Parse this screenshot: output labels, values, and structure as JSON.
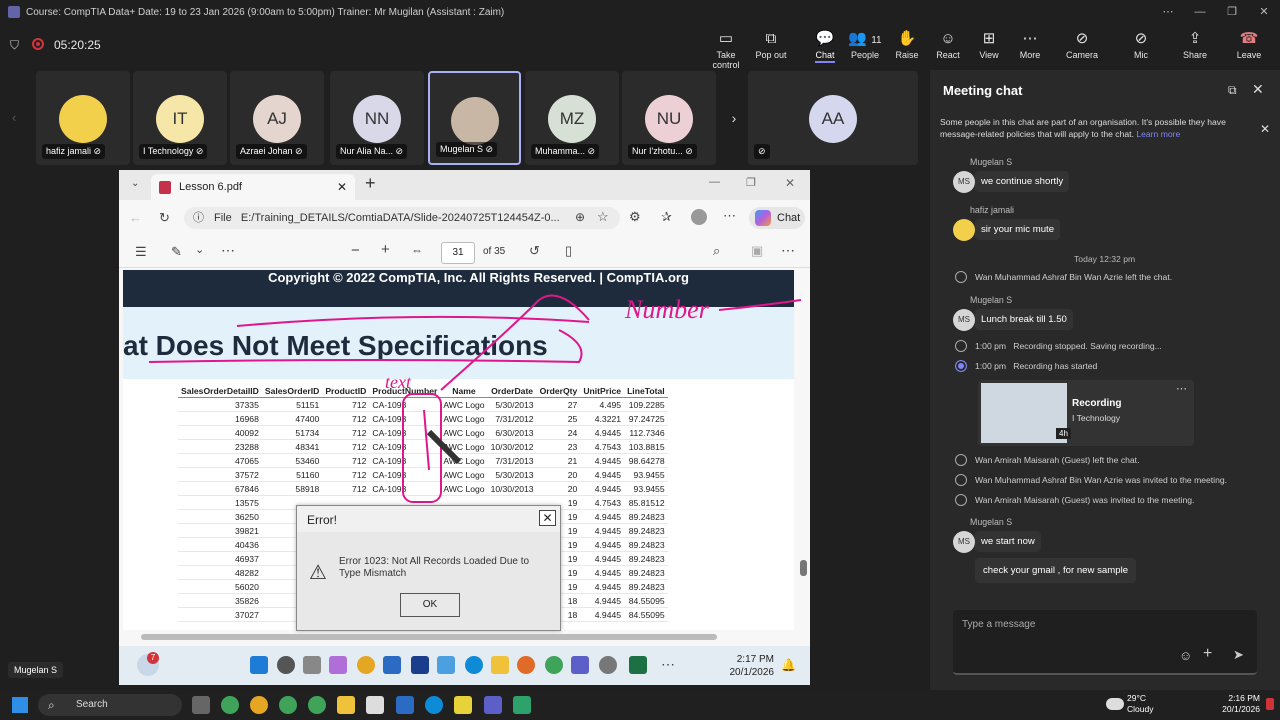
{
  "titlebar": {
    "text": "Course: CompTIA Data+ Date: 19 to 23 Jan 2026 (9:00am to 5:00pm) Trainer: Mr Mugilan (Assistant : Zaim)"
  },
  "toolbar": {
    "timer": "05:20:25",
    "buttons": [
      {
        "label": "Take control",
        "icon": "take-control-icon",
        "glyph": "▭"
      },
      {
        "label": "Pop out",
        "icon": "pop-out-icon",
        "glyph": "⧉"
      },
      {
        "label": "Chat",
        "icon": "chat-icon",
        "glyph": "💬"
      },
      {
        "label": "People",
        "icon": "people-icon",
        "glyph": "👥",
        "count": "11"
      },
      {
        "label": "Raise",
        "icon": "raise-hand-icon",
        "glyph": "✋"
      },
      {
        "label": "React",
        "icon": "react-icon",
        "glyph": "☺"
      },
      {
        "label": "View",
        "icon": "view-icon",
        "glyph": "⊞"
      },
      {
        "label": "More",
        "icon": "more-icon",
        "glyph": "⋯"
      },
      {
        "label": "Camera",
        "icon": "camera-off-icon",
        "glyph": "⊘"
      },
      {
        "label": "Mic",
        "icon": "mic-off-icon",
        "glyph": "⊘"
      },
      {
        "label": "Share",
        "icon": "share-icon",
        "glyph": "⇪"
      },
      {
        "label": "Leave",
        "icon": "leave-icon",
        "glyph": "☎"
      }
    ]
  },
  "participants": [
    {
      "name": "hafiz jamali",
      "initials": "",
      "color": "#f2d04b"
    },
    {
      "name": "I Technology",
      "initials": "IT",
      "color": "#f6e7a8"
    },
    {
      "name": "Azraei Johan",
      "initials": "AJ",
      "color": "#e5d5cf"
    },
    {
      "name": "Nur Alia Na...",
      "initials": "NN",
      "color": "#d8d8e8"
    },
    {
      "name": "Mugelan S",
      "initials": "",
      "color": "#c9b7a6"
    },
    {
      "name": "Muhamma...",
      "initials": "MZ",
      "color": "#d6e0d4"
    },
    {
      "name": "Nur I'zhotu...",
      "initials": "NU",
      "color": "#edd0d6"
    },
    {
      "name": "",
      "initials": "AA",
      "color": "#d4d7ee"
    }
  ],
  "browser": {
    "tab_title": "Lesson 6.pdf",
    "address_prefix": "File",
    "address": "E:/Training_DETAILS/ComtiaDATA/Slide-20240725T124454Z-0...",
    "copilot_label": "Chat",
    "page_current": "31",
    "page_total": "of 35"
  },
  "slide": {
    "header": "Copyright © 2022 CompTIA, Inc. All Rights Reserved.  |  CompTIA.org",
    "title": "at Does Not Meet Specifications",
    "columns": [
      "SalesOrderDetailID",
      "SalesOrderID",
      "ProductID",
      "ProductNumber",
      "Name",
      "OrderDate",
      "OrderQty",
      "UnitPrice",
      "LineTotal"
    ],
    "rows": [
      [
        "37335",
        "51151",
        "712",
        "CA-1098",
        "AWC Logo",
        "5/30/2013",
        "27",
        "4.495",
        "109.2285"
      ],
      [
        "16968",
        "47400",
        "712",
        "CA-1098",
        "AWC Logo",
        "7/31/2012",
        "25",
        "4.3221",
        "97.24725"
      ],
      [
        "40092",
        "51734",
        "712",
        "CA-1098",
        "AWC Logo",
        "6/30/2013",
        "24",
        "4.9445",
        "112.7346"
      ],
      [
        "23288",
        "48341",
        "712",
        "CA-1098",
        "AWC Logo",
        "10/30/2012",
        "23",
        "4.7543",
        "103.8815"
      ],
      [
        "47065",
        "53460",
        "712",
        "CA-1098",
        "AWC Logo",
        "7/31/2013",
        "21",
        "4.9445",
        "98.64278"
      ],
      [
        "37572",
        "51160",
        "712",
        "CA-1098",
        "AWC Logo",
        "5/30/2013",
        "20",
        "4.9445",
        "93.9455"
      ],
      [
        "67846",
        "58918",
        "712",
        "CA-1098",
        "AWC Logo",
        "10/30/2013",
        "20",
        "4.9445",
        "93.9455"
      ],
      [
        "13575",
        "",
        "",
        "",
        "",
        "",
        "19",
        "4.7543",
        "85.81512"
      ],
      [
        "36250",
        "",
        "",
        "",
        "",
        "",
        "19",
        "4.9445",
        "89.24823"
      ],
      [
        "39821",
        "",
        "",
        "",
        "",
        "",
        "19",
        "4.9445",
        "89.24823"
      ],
      [
        "40436",
        "",
        "",
        "",
        "",
        "",
        "19",
        "4.9445",
        "89.24823"
      ],
      [
        "46937",
        "",
        "",
        "",
        "",
        "",
        "19",
        "4.9445",
        "89.24823"
      ],
      [
        "48282",
        "",
        "",
        "",
        "",
        "",
        "19",
        "4.9445",
        "89.24823"
      ],
      [
        "56020",
        "",
        "",
        "",
        "",
        "",
        "19",
        "4.9445",
        "89.24823"
      ],
      [
        "35826",
        "",
        "",
        "",
        "",
        "",
        "18",
        "4.9445",
        "84.55095"
      ],
      [
        "37027",
        "",
        "",
        "",
        "",
        "",
        "18",
        "4.9445",
        "84.55095"
      ]
    ],
    "annotations": {
      "text1": "text",
      "text2": "Number"
    }
  },
  "error_dialog": {
    "title": "Error!",
    "message": "Error 1023: Not All Records Loaded Due to Type Mismatch",
    "ok_label": "OK"
  },
  "inner_taskbar": {
    "time": "2:17 PM",
    "date": "20/1/2026",
    "badge": "7"
  },
  "chat": {
    "title": "Meeting chat",
    "notice": "Some people in this chat are part of an organisation. It's possible they have message-related policies that will apply to the chat.",
    "notice_link": "Learn more",
    "messages": [
      {
        "author": "Mugelan S",
        "initials": "MS",
        "text": "we continue shortly"
      },
      {
        "author": "hafiz jamali",
        "initials": "",
        "text": "sir your mic mute"
      }
    ],
    "divider": "Today 12:32 pm",
    "sys1": "Wan Muhammad Ashraf Bin Wan Azrie left the chat.",
    "msg3": {
      "author": "Mugelan S",
      "initials": "MS",
      "text": "Lunch break till 1.50"
    },
    "rec1_time": "1:00 pm",
    "rec1_text": "Recording stopped. Saving recording...",
    "rec2_time": "1:00 pm",
    "rec2_text": "Recording has started",
    "recording_card": {
      "title": "Recording",
      "subtitle": "I Technology",
      "duration": "4h"
    },
    "sys2": "Wan Amirah Maisarah (Guest) left the chat.",
    "sys3": "Wan Muhammad Ashraf Bin Wan Azrie was invited to the meeting.",
    "sys4": "Wan Amirah Maisarah (Guest) was invited to the meeting.",
    "msg4": {
      "author": "Mugelan S",
      "initials": "MS",
      "text": "we start now"
    },
    "msg5": {
      "text": "check your gmail , for new sample"
    },
    "input_placeholder": "Type a message"
  },
  "presenter_label": "Mugelan S",
  "os_taskbar": {
    "search": "Search",
    "weather_temp": "29°C",
    "weather_desc": "Cloudy",
    "time": "2:16 PM",
    "date": "20/1/2026"
  },
  "colors": {
    "accent": "#7f85f5",
    "leave": "#c4314b",
    "recording": "#d13438"
  }
}
